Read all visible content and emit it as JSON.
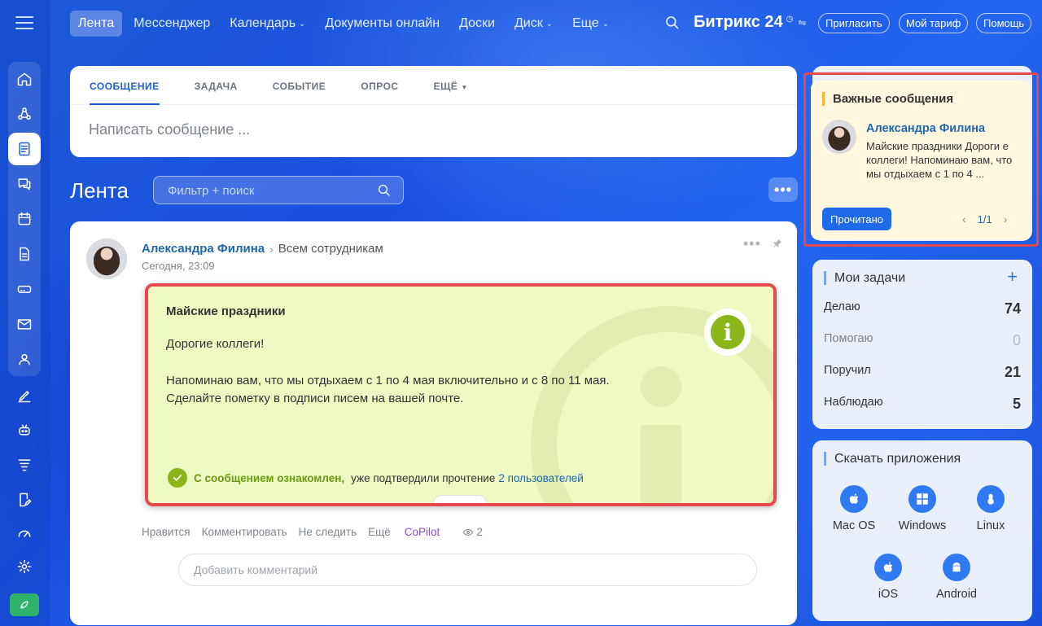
{
  "nav": {
    "items": [
      {
        "label": "Лента",
        "active": true,
        "dropdown": false
      },
      {
        "label": "Мессенджер",
        "active": false,
        "dropdown": false
      },
      {
        "label": "Календарь",
        "active": false,
        "dropdown": true
      },
      {
        "label": "Документы онлайн",
        "active": false,
        "dropdown": false
      },
      {
        "label": "Доски",
        "active": false,
        "dropdown": false
      },
      {
        "label": "Диск",
        "active": false,
        "dropdown": true
      },
      {
        "label": "Еще",
        "active": false,
        "dropdown": true
      }
    ],
    "brand": "Битрикс 24",
    "invite": "Пригласить",
    "tariff": "Мой тариф",
    "help": "Помощь"
  },
  "composer": {
    "tabs": [
      "СООБЩЕНИЕ",
      "ЗАДАЧА",
      "СОБЫТИЕ",
      "ОПРОС",
      "ЕЩЁ"
    ],
    "placeholder": "Написать сообщение ..."
  },
  "feed": {
    "title": "Лента",
    "filter_placeholder": "Фильтр + поиск"
  },
  "post": {
    "author": "Александра Филина",
    "recipient": "Всем сотрудникам",
    "time": "Сегодня, 23:09",
    "title": "Майские праздники",
    "greeting": "Дорогие коллеги!",
    "line1": "Напоминаю вам, что мы отдыхаем с 1 по 4 мая включительно и с 8 по 11 мая.",
    "line2": "Сделайте пометку в подписи писем на вашей почте.",
    "confirm_strong": "С сообщением ознакомлен,",
    "confirm_text": "уже подтвердили прочтение",
    "confirm_link": "2 пользователей",
    "actions": {
      "like": "Нравится",
      "comment": "Комментировать",
      "unfollow": "Не следить",
      "more": "Ещё",
      "copilot": "CoPilot",
      "views": "2"
    },
    "comment_placeholder": "Добавить комментарий"
  },
  "important": {
    "title": "Важные сообщения",
    "author": "Александра Филина",
    "text": "Майские праздники Дороги е коллеги! Напоминаю вам, что мы отдыхаем с 1 по 4 ...",
    "read_button": "Прочитано",
    "pager": "1/1"
  },
  "tasks": {
    "title": "Мои задачи",
    "rows": [
      {
        "label": "Делаю",
        "count": "74"
      },
      {
        "label": "Помогаю",
        "count": "0"
      },
      {
        "label": "Поручил",
        "count": "21"
      },
      {
        "label": "Наблюдаю",
        "count": "5"
      }
    ]
  },
  "apps": {
    "title": "Скачать приложения",
    "items": [
      "Mac OS",
      "Windows",
      "Linux",
      "iOS",
      "Android"
    ]
  },
  "colors": {
    "accent": "#1e6ae8",
    "highlight_border": "#e5494d",
    "important_bg": "#eefac2",
    "success": "#8ab61a"
  }
}
